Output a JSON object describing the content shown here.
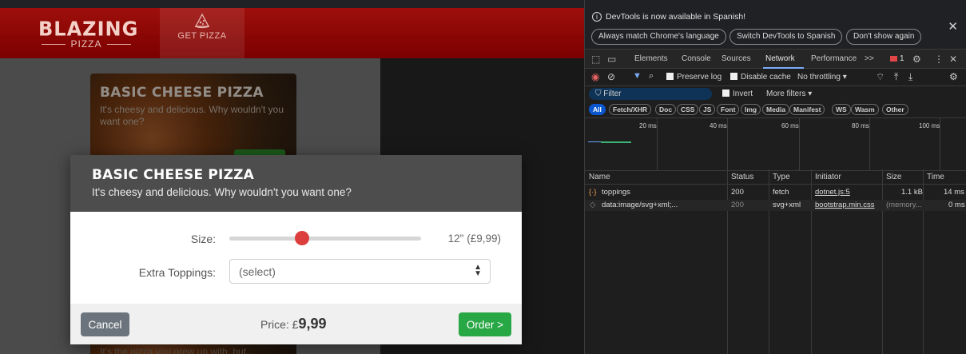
{
  "app": {
    "brand": {
      "main": "BLAZING",
      "sub": "PIZZA"
    },
    "nav": {
      "get_pizza_label": "GET PIZZA"
    },
    "cards": [
      {
        "title": "BASIC CHEESE PIZZA",
        "description": "It's cheesy and delicious. Why wouldn't you want one?"
      },
      {
        "title": "",
        "description": "It's the pizza you grew up with, but..."
      }
    ]
  },
  "modal": {
    "title": "BASIC CHEESE PIZZA",
    "subtitle": "It's cheesy and delicious. Why wouldn't you want one?",
    "size_label": "Size:",
    "size_value": "12\" (£9,99)",
    "size_slider_fraction": 0.38,
    "toppings_label": "Extra Toppings:",
    "toppings_value": "(select)",
    "cancel_label": "Cancel",
    "price_prefix": "Price: £",
    "price_value": "9,99",
    "order_label": "Order >",
    "accent_color": "#28a745",
    "thumb_color": "#dc3d3d"
  },
  "devtools": {
    "info_text": "DevTools is now available in Spanish!",
    "info_buttons": [
      "Always match Chrome's language",
      "Switch DevTools to Spanish",
      "Don't show again"
    ],
    "tabs": [
      "Elements",
      "Console",
      "Sources",
      "Network",
      "Performance"
    ],
    "active_tab": "Network",
    "more_tabs": ">>",
    "issues_count": "1",
    "toolbar": {
      "preserve_log": "Preserve log",
      "disable_cache": "Disable cache",
      "throttling": "No throttling"
    },
    "filter_placeholder": "Filter",
    "invert_label": "Invert",
    "more_filters_label": "More filters",
    "type_filters": [
      "All",
      "Fetch/XHR",
      "Doc",
      "CSS",
      "JS",
      "Font",
      "Img",
      "Media",
      "Manifest",
      "WS",
      "Wasm",
      "Other"
    ],
    "overview_ticks": [
      "20 ms",
      "40 ms",
      "60 ms",
      "80 ms",
      "100 ms"
    ],
    "columns": [
      "Name",
      "Status",
      "Type",
      "Initiator",
      "Size",
      "Time"
    ],
    "requests": [
      {
        "name": "toppings",
        "status": "200",
        "type": "fetch",
        "initiator": "dotnet.js:5",
        "size": "1.1 kB",
        "time": "14 ms"
      },
      {
        "name": "data:image/svg+xml;...",
        "status": "200",
        "type": "svg+xml",
        "initiator": "bootstrap.min.css",
        "size": "(memory...",
        "time": "0 ms"
      }
    ]
  }
}
